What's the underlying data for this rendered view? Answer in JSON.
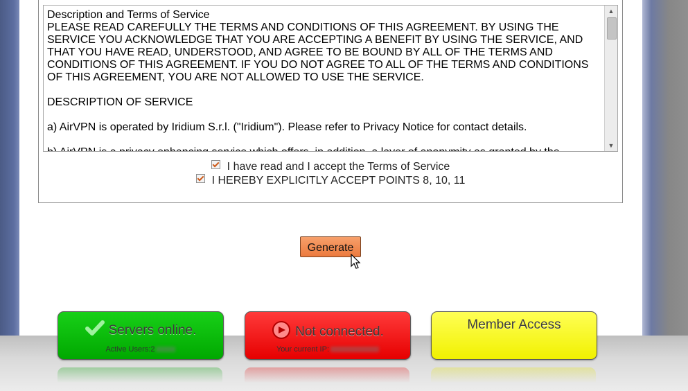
{
  "tos": {
    "title": "Description and Terms of Service",
    "text": "Description and Terms of Service\nPLEASE READ CAREFULLY THE TERMS AND CONDITIONS OF THIS AGREEMENT. BY USING THE SERVICE YOU ACKNOWLEDGE THAT YOU ARE ACCEPTING A BENEFIT BY USING THE SERVICE, AND THAT YOU HAVE READ, UNDERSTOOD, AND AGREE TO BE BOUND BY ALL OF THE TERMS AND CONDITIONS OF THIS AGREEMENT. IF YOU DO NOT AGREE TO ALL OF THE TERMS AND CONDITIONS OF THIS AGREEMENT, YOU ARE NOT ALLOWED TO USE THE SERVICE.\n\nDESCRIPTION OF SERVICE\n\na) AirVPN is operated by Iridium S.r.l. (\"Iridium\"). Please refer to Privacy Notice for contact details.\n\nb) AirVPN is a privacy enhancing service which offers, in addition, a layer of anonymity as granted by the"
  },
  "checkboxes": {
    "accept_tos": "I have read and I accept the Terms of Service",
    "accept_points": "I HEREBY EXPLICITLY ACCEPT POINTS 8, 10, 11"
  },
  "generate_button": "Generate",
  "status": {
    "servers": {
      "title": "Servers online.",
      "sub": "Active Users:",
      "value": "2"
    },
    "connection": {
      "title": "Not connected.",
      "sub": "Your current IP:"
    },
    "member": {
      "title": "Member Access"
    }
  },
  "colors": {
    "green_card": "#00b800",
    "red_card": "#f20000",
    "yellow_card": "#ffff33",
    "generate_button": "#f28a50"
  },
  "icons": {
    "servers": "checkmark-icon",
    "connection": "disconnected-icon",
    "cursor": "mouse-pointer-icon"
  }
}
